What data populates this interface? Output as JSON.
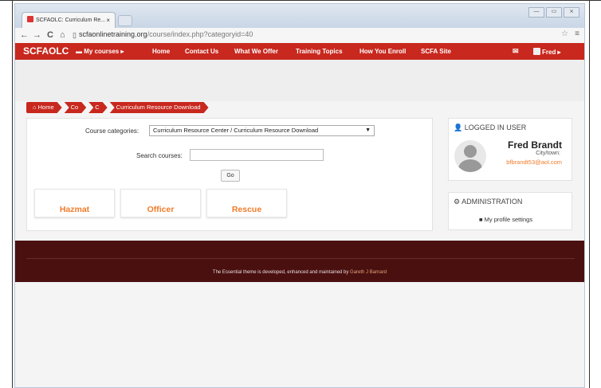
{
  "browser": {
    "tab_title": "SCFAOLC: Curriculum Re...",
    "tab_close": "×",
    "url_host": "scfaonlinetraining.org",
    "url_path": "/course/index.php?categoryid=40",
    "back": "←",
    "forward": "→",
    "reload": "C",
    "home": "⌂",
    "page_icon": "▯",
    "star": "☆",
    "menu": "≡",
    "minimize": "—",
    "maximize": "▭",
    "close": "⨯"
  },
  "navbar": {
    "brand": "SCFAOLC",
    "items": [
      "My courses ▸",
      "Home",
      "Contact Us",
      "What We Offer",
      "Training Topics",
      "How You Enroll",
      "SCFA Site"
    ],
    "mail_icon": "✉",
    "user": "Fred ▸"
  },
  "breadcrumb": [
    "Home",
    "Co",
    "C",
    "Curriculum Resource Download"
  ],
  "search": {
    "category_label": "Course categories:",
    "category_value": "Curriculum Resource Center / Curriculum Resource Download",
    "search_label": "Search courses:",
    "search_value": "",
    "go_label": "Go"
  },
  "tiles": [
    "Hazmat",
    "Officer",
    "Rescue"
  ],
  "logged_in": {
    "header": "LOGGED IN USER",
    "name": "Fred Brandt",
    "city": "City/town:",
    "email": "bfbrandt53@aol.com"
  },
  "admin": {
    "header": "ADMINISTRATION",
    "link": "My profile settings"
  },
  "footer": {
    "text": "The Essential theme is developed, enhanced and maintained by ",
    "author": "Gareth J Barnard"
  },
  "colors": {
    "brand_red": "#c8281e",
    "footer": "#4a1010",
    "accent_orange": "#f07c2a"
  }
}
